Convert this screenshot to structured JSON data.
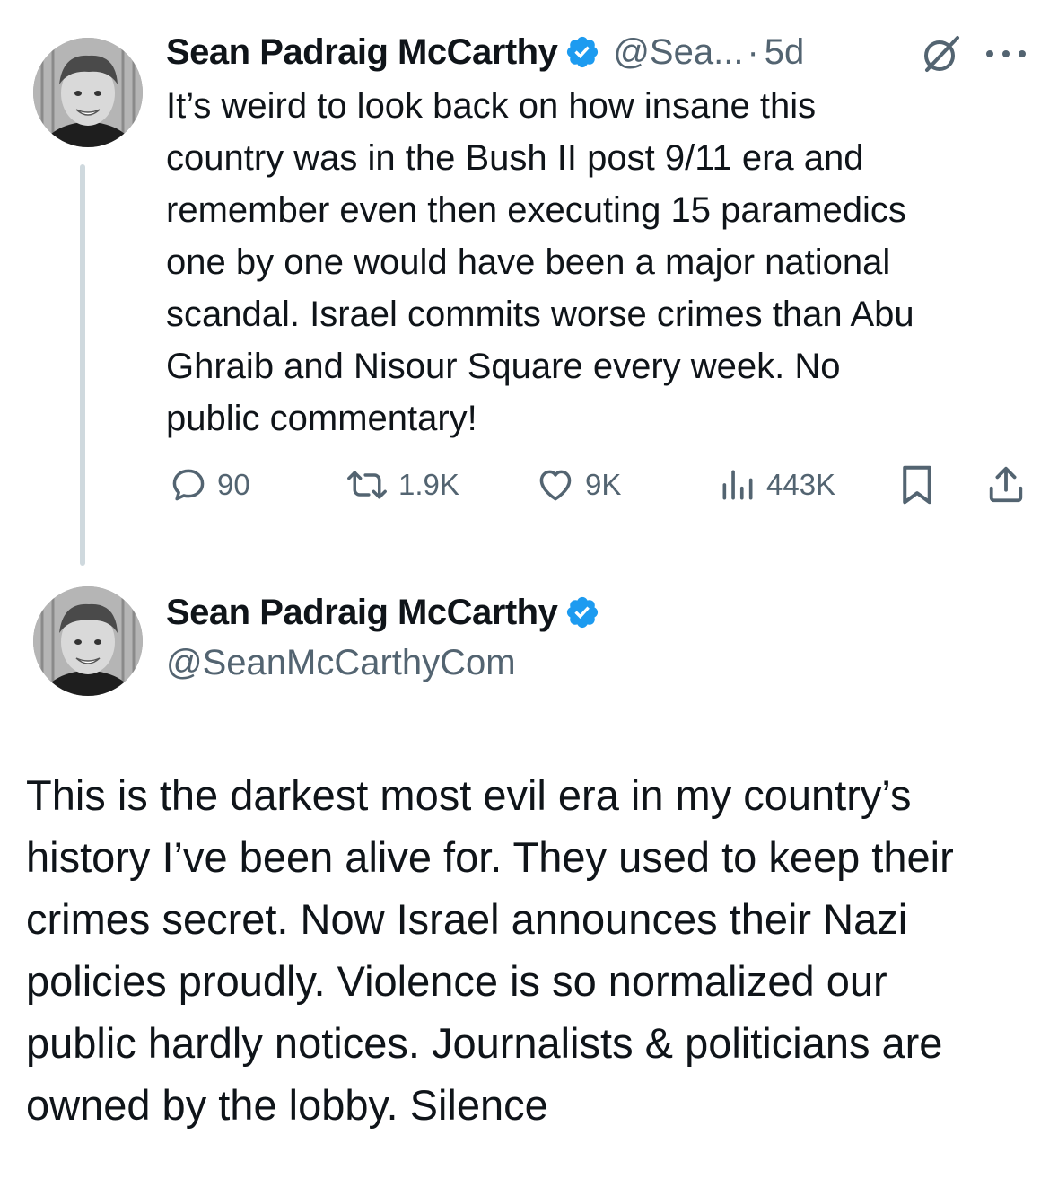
{
  "colors": {
    "verified_badge": "#1d9bf0",
    "secondary_text": "#536471",
    "thread_line": "#cfd9de",
    "primary_text": "#0f1419"
  },
  "tweet1": {
    "author_name": "Sean Padraig McCarthy",
    "handle_truncated": "@Sea...",
    "separator": "·",
    "time": "5d",
    "icons": [
      "verified-badge-icon",
      "grok-icon",
      "more-icon"
    ],
    "text_lines": [
      "It’s weird to look back on how insane this",
      "country was in the Bush II post 9/11 era and",
      "remember even then executing 15 paramedics",
      "one by one would have been a major national",
      "scandal. Israel commits worse crimes than Abu",
      "Ghraib and  Nisour Square every week. No",
      "public commentary!"
    ],
    "actions": {
      "replies": "90",
      "reposts": "1.9K",
      "likes": "9K",
      "views": "443K"
    }
  },
  "tweet2": {
    "author_name": "Sean Padraig McCarthy",
    "handle": "@SeanMcCarthyCom",
    "text_lines": [
      "This is the darkest most evil era in my country’s",
      "history I’ve been alive for. They used to keep their",
      "crimes secret. Now Israel announces their Nazi",
      "policies proudly. Violence is so normalized our",
      "public hardly notices. Journalists & politicians are",
      "owned by the lobby. Silence"
    ]
  }
}
